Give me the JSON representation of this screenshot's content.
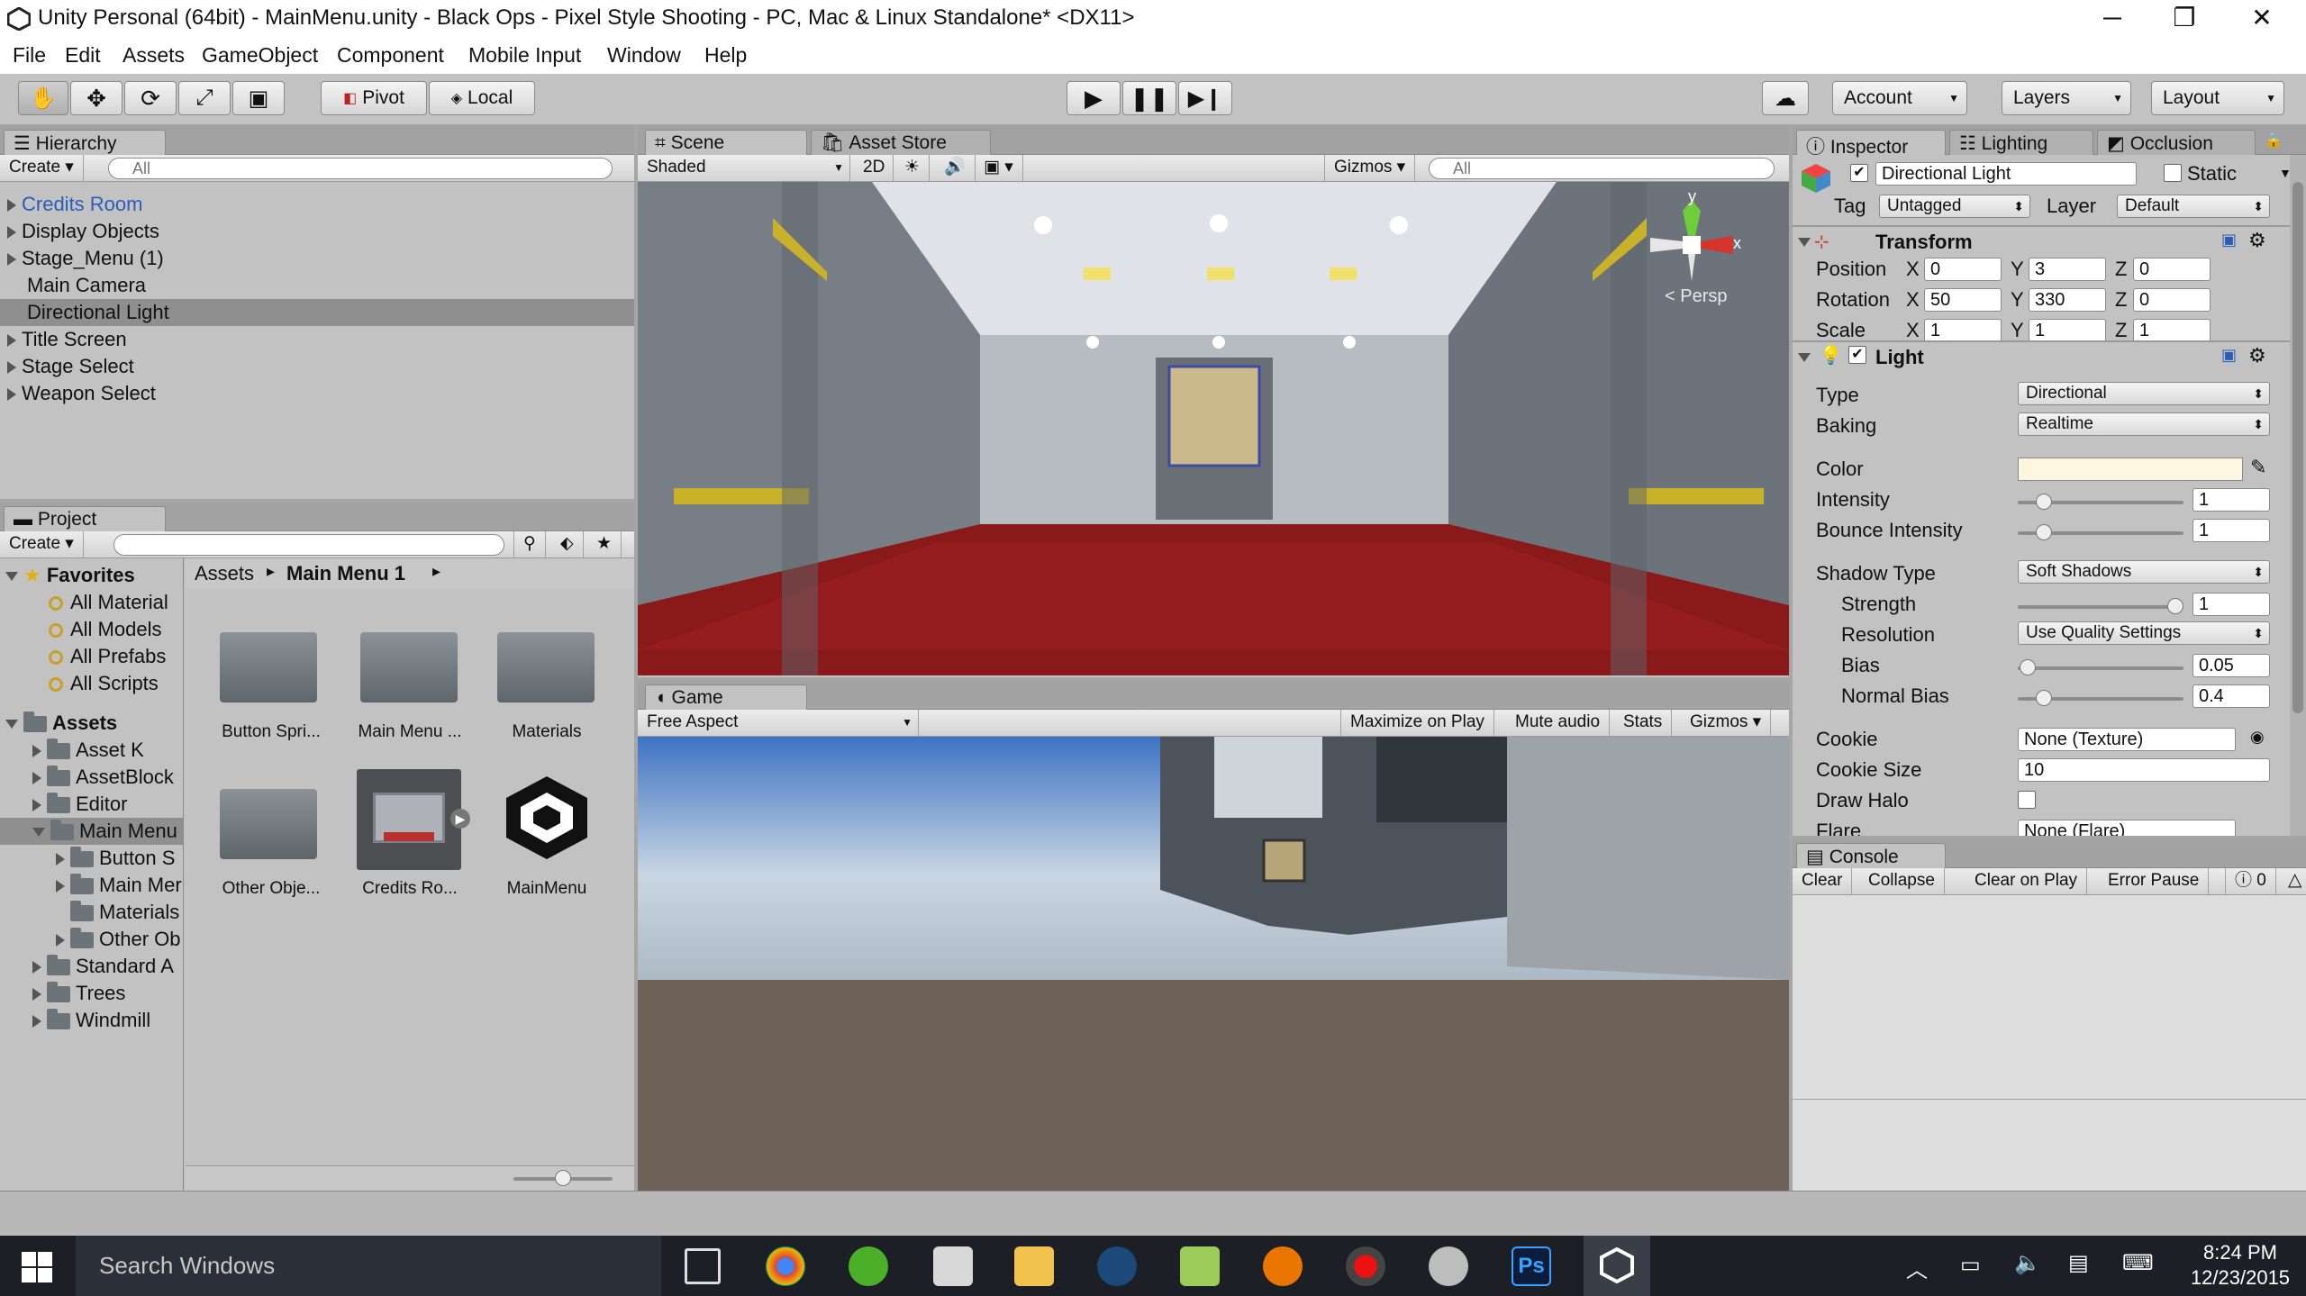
{
  "window": {
    "title": "Unity Personal (64bit) - MainMenu.unity - Black Ops - Pixel Style Shooting - PC, Mac & Linux Standalone* <DX11>",
    "minimize": "─",
    "maximize": "❐",
    "close": "✕"
  },
  "menu": [
    "File",
    "Edit",
    "Assets",
    "GameObject",
    "Component",
    "Mobile Input",
    "Window",
    "Help"
  ],
  "toolbar": {
    "pivot": "Pivot",
    "local": "Local",
    "account": "Account",
    "layers": "Layers",
    "layout": "Layout"
  },
  "hierarchy": {
    "tab": "Hierarchy",
    "create": "Create",
    "search_placeholder": "All",
    "items": [
      "Credits Room",
      "Display Objects",
      "Stage_Menu (1)",
      "Main Camera",
      "Directional Light",
      "Title Screen",
      "Stage Select",
      "Weapon Select"
    ]
  },
  "project": {
    "tab": "Project",
    "create": "Create",
    "favorites": {
      "label": "Favorites",
      "items": [
        "All Material",
        "All Models",
        "All Prefabs",
        "All Scripts"
      ]
    },
    "assets": {
      "label": "Assets",
      "items": [
        "Asset K",
        "AssetBlock",
        "Editor",
        "Main Menu",
        "Button S",
        "Main Mer",
        "Materials",
        "Other Ob",
        "Standard A",
        "Trees",
        "Windmill"
      ]
    },
    "breadcrumb": {
      "root": "Assets",
      "current": "Main Menu 1"
    },
    "grid": [
      "Button Spri...",
      "Main Menu ...",
      "Materials",
      "Other Obje...",
      "Credits Ro...",
      "MainMenu"
    ],
    "zoom": 0.5
  },
  "scene": {
    "tab": "Scene",
    "asset_tab": "Asset Store",
    "shading": "Shaded",
    "mode2d": "2D",
    "gizmos": "Gizmos",
    "search_placeholder": "All",
    "persp": "< Persp",
    "axis_y": "y",
    "axis_x": "x"
  },
  "game": {
    "tab": "Game",
    "aspect": "Free Aspect",
    "buttons": [
      "Maximize on Play",
      "Mute audio",
      "Stats",
      "Gizmos"
    ]
  },
  "inspector": {
    "tabs": [
      "Inspector",
      "Lighting",
      "Occlusion"
    ],
    "object_name": "Directional Light",
    "static_label": "Static",
    "tag_label": "Tag",
    "tag_value": "Untagged",
    "layer_label": "Layer",
    "layer_value": "Default",
    "transform": {
      "title": "Transform",
      "rows": [
        {
          "label": "Position",
          "x": "0",
          "y": "3",
          "z": "0"
        },
        {
          "label": "Rotation",
          "x": "50",
          "y": "330",
          "z": "0"
        },
        {
          "label": "Scale",
          "x": "1",
          "y": "1",
          "z": "1"
        }
      ]
    },
    "light": {
      "title": "Light",
      "type_label": "Type",
      "type_value": "Directional",
      "baking_label": "Baking",
      "baking_value": "Realtime",
      "color_label": "Color",
      "color_value": "#fff6e0",
      "intensity_label": "Intensity",
      "intensity": "1",
      "bounce_label": "Bounce Intensity",
      "bounce": "1",
      "shadow_label": "Shadow Type",
      "shadow_value": "Soft Shadows",
      "strength_label": "Strength",
      "strength": "1",
      "resolution_label": "Resolution",
      "resolution_value": "Use Quality Settings",
      "bias_label": "Bias",
      "bias": "0.05",
      "normal_bias_label": "Normal Bias",
      "normal_bias": "0.4",
      "cookie_label": "Cookie",
      "cookie_value": "None (Texture)",
      "cookie_size_label": "Cookie Size",
      "cookie_size": "10",
      "halo_label": "Draw Halo",
      "flare_label": "Flare",
      "flare_value": "None (Flare)"
    }
  },
  "console": {
    "tab": "Console",
    "buttons": [
      "Clear",
      "Collapse",
      "Clear on Play",
      "Error Pause"
    ],
    "count": "0"
  },
  "taskbar": {
    "search": "Search Windows",
    "time": "8:24 PM",
    "date": "12/23/2015",
    "ps": "Ps"
  },
  "colors": {
    "accent_blue": "#2b5cb8",
    "selected": "#8f8f8f",
    "taskbar": "#1c1f26"
  }
}
